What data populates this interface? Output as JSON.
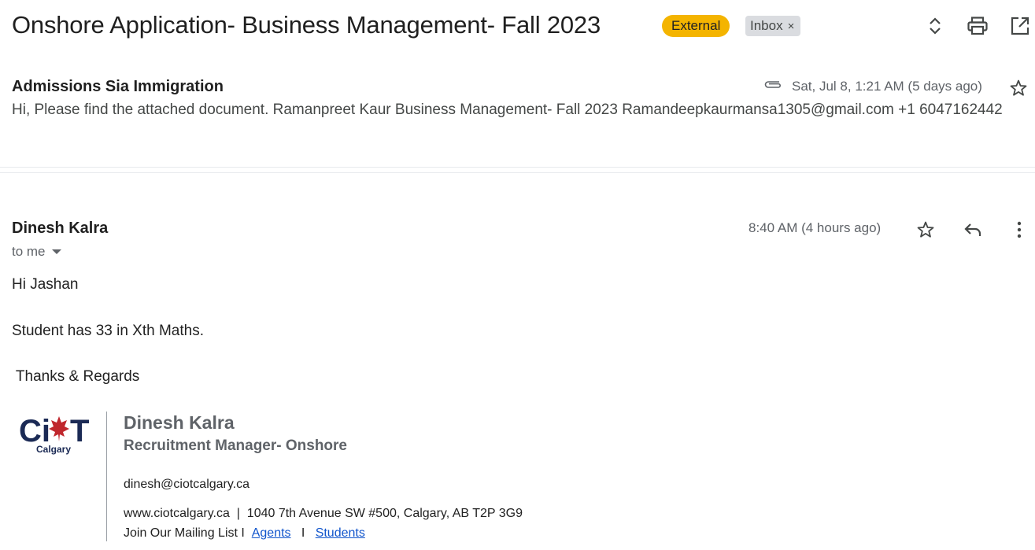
{
  "thread": {
    "subject": "Onshore Application- Business Management- Fall 2023",
    "labels": [
      {
        "text": "External",
        "color": "#f4b400"
      },
      {
        "text": "Inbox",
        "removable_glyph": "×"
      }
    ],
    "toolbar_icons": [
      "expand-collapse-icon",
      "print-icon",
      "open-in-new-window-icon"
    ]
  },
  "message1": {
    "sender": "Admissions Sia Immigration",
    "has_attachment": true,
    "date": "Sat, Jul 8, 1:21 AM (5 days ago)",
    "snippet": "Hi, Please find the attached document. Ramanpreet Kaur Business Management- Fall 2023 Ramandeepkaurmansa1305@gmail.com +1 6047162442"
  },
  "message2": {
    "sender": "Dinesh Kalra",
    "date": "8:40 AM (4 hours ago)",
    "recipient": "to me",
    "body": {
      "greeting": "Hi Jashan",
      "line1": "Student has 33 in Xth Maths.",
      "closing": " Thanks & Regards"
    },
    "signature": {
      "logo_text": "CiT",
      "logo_sub": "Calgary",
      "name": "Dinesh Kalra",
      "title": "Recruitment Manager- Onshore",
      "email": "dinesh@ciotcalgary.ca",
      "website": "www.ciotcalgary.ca",
      "separator": "|",
      "address": "1040 7th Avenue SW #500, Calgary, AB T2P 3G9",
      "mailing_list": "Join Our Mailing List I",
      "link_agents": "Agents",
      "link_sep": "I",
      "link_students": "Students"
    }
  }
}
